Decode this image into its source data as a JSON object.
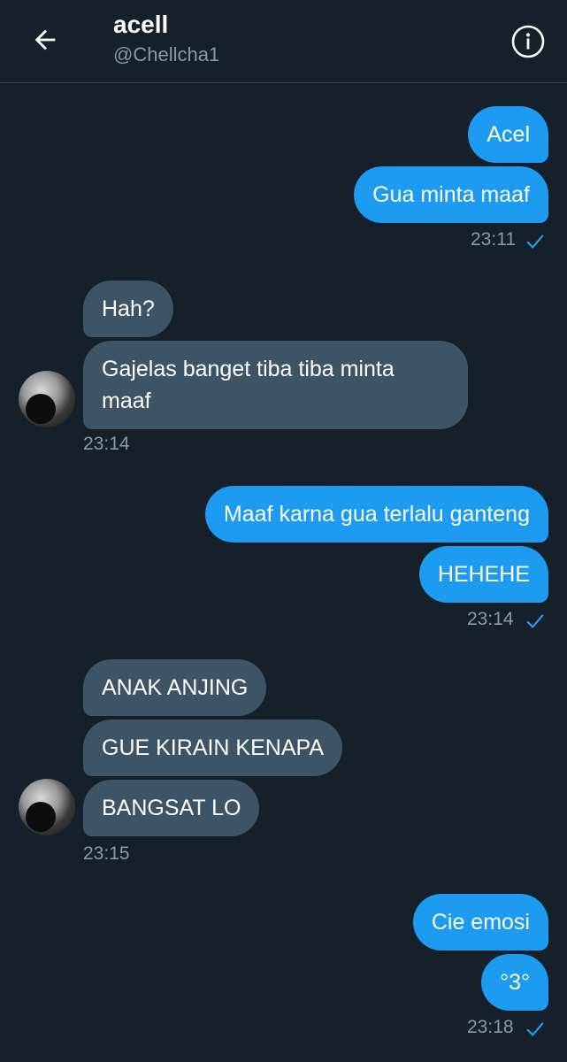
{
  "header": {
    "title": "acell",
    "handle": "@Chellcha1"
  },
  "messages": [
    {
      "dir": "out",
      "text": "Acel"
    },
    {
      "dir": "out",
      "text": "Gua minta maaf"
    },
    {
      "dir": "out",
      "time": "23:11"
    },
    {
      "dir": "in",
      "text": "Hah?"
    },
    {
      "dir": "in",
      "text": "Gajelas banget tiba tiba minta maaf"
    },
    {
      "dir": "in",
      "time": "23:14"
    },
    {
      "dir": "out",
      "text": "Maaf karna gua terlalu ganteng"
    },
    {
      "dir": "out",
      "text": "HEHEHE"
    },
    {
      "dir": "out",
      "time": "23:14"
    },
    {
      "dir": "in",
      "text": "ANAK ANJING"
    },
    {
      "dir": "in",
      "text": "GUE KIRAIN KENAPA"
    },
    {
      "dir": "in",
      "text": "BANGSAT LO"
    },
    {
      "dir": "in",
      "time": "23:15"
    },
    {
      "dir": "out",
      "text": "Cie emosi"
    },
    {
      "dir": "out",
      "text": "°3°"
    },
    {
      "dir": "out",
      "time": "23:18"
    }
  ],
  "colors": {
    "background": "#15202b",
    "outgoing_bubble": "#1d9bf0",
    "incoming_bubble": "#3d5466",
    "muted_text": "#8b98a5",
    "read_check": "#1d9bf0"
  },
  "icons": {
    "back": "arrow-left-icon",
    "info": "info-icon",
    "read_receipt": "checkmark-icon"
  }
}
